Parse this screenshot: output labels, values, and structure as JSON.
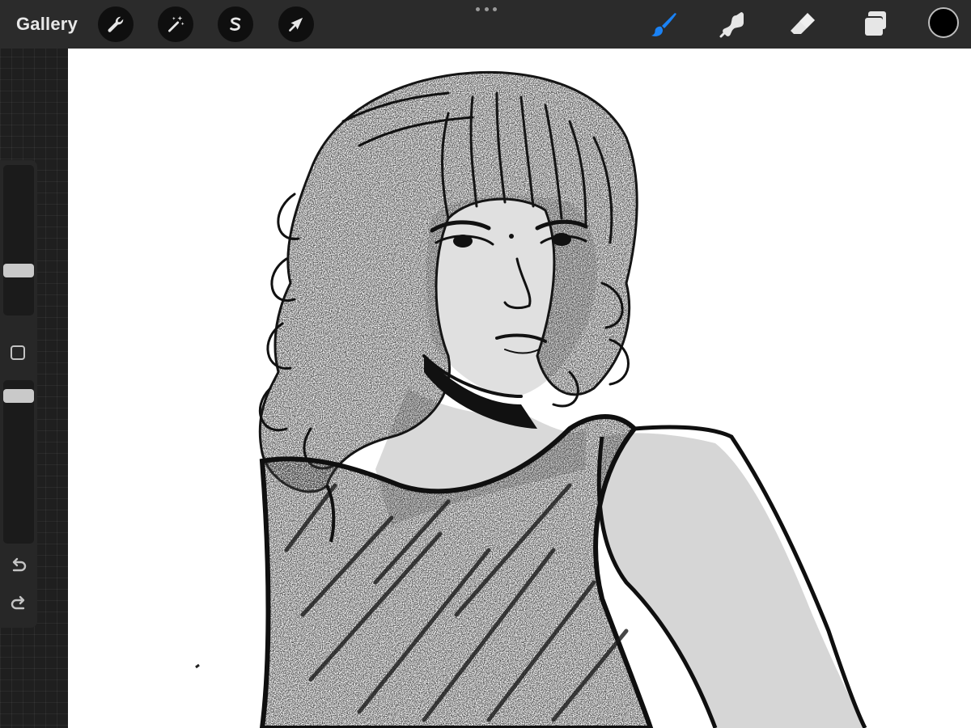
{
  "topbar": {
    "gallery_label": "Gallery",
    "actions_icon": "wrench-icon",
    "adjustments_icon": "magic-wand-icon",
    "selection_icon": "selection-s-icon",
    "transform_icon": "arrow-cursor-icon",
    "brush_icon": "brush-icon",
    "smudge_icon": "smudge-icon",
    "eraser_icon": "eraser-icon",
    "layers_icon": "layers-icon",
    "active_tool": "brush",
    "active_color": "#000000",
    "accent_color": "#1a82f5"
  },
  "sidebar": {
    "brush_size_level": 0.28,
    "opacity_level": 0.94,
    "undo_icon": "undo-icon",
    "redo_icon": "redo-icon"
  }
}
